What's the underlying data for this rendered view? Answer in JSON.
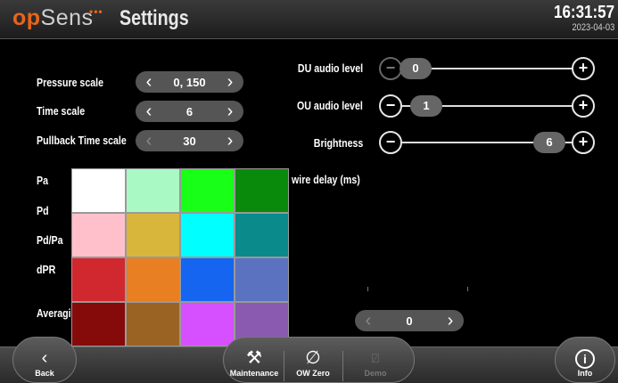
{
  "header": {
    "logo_op": "op",
    "logo_sens": "Sens",
    "logo_dots": "•••",
    "title": "Settings",
    "time": "16:31:57",
    "date": "2023-04-03"
  },
  "left_settings": [
    {
      "label": "Pressure scale",
      "value": "0, 150"
    },
    {
      "label": "Time scale",
      "value": "6"
    },
    {
      "label": "Pullback Time scale",
      "value": "30"
    }
  ],
  "right_settings": [
    {
      "label": "DU audio level",
      "value": "0"
    },
    {
      "label": "OU audio level",
      "value": "1"
    },
    {
      "label": "Brightness",
      "value": "6"
    }
  ],
  "wire_delay_label": "wire delay (ms)",
  "wire_delay_value": "0",
  "color_rows": [
    "Pa",
    "Pd",
    "Pd/Pa",
    "dPR",
    "Averagi"
  ],
  "colors": [
    "#ffffff",
    "#a9f9c4",
    "#18ff18",
    "#0a8a0a",
    "#ffc0cc",
    "#d8b63c",
    "#00ffff",
    "#0a8a8a",
    "#d0282e",
    "#e87f23",
    "#1565f0",
    "#5a72c0",
    "#850a0a",
    "#9a6324",
    "#d650ff",
    "#8a5ab0"
  ],
  "footer": {
    "back": "Back",
    "maintenance": "Maintenance",
    "ow_zero": "OW Zero",
    "demo": "Demo",
    "info": "Info"
  },
  "icons": {
    "back": "chevron-left-icon",
    "maintenance": "tools-icon",
    "ow_zero": "null-icon",
    "demo": "demo-icon",
    "info": "info-icon"
  }
}
